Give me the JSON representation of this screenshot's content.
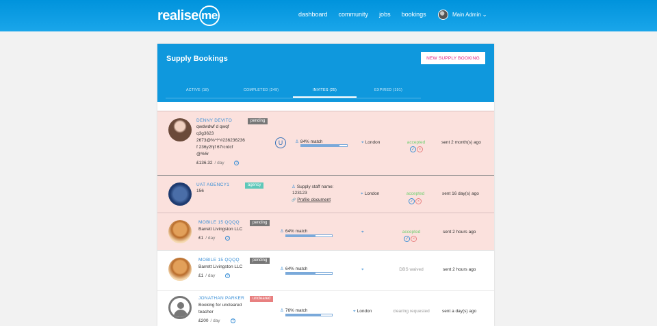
{
  "nav": {
    "logo_text": "realise",
    "logo_me": "me",
    "links": [
      "dashboard",
      "community",
      "jobs",
      "bookings"
    ],
    "user_name": "Main Admin",
    "user_caret": "⌄"
  },
  "panel": {
    "title": "Supply Bookings",
    "new_button": "NEW SUPPLY BOOKING",
    "tabs": [
      {
        "label": "ACTIVE (18)"
      },
      {
        "label": "COMPLETED (249)"
      },
      {
        "label": "INVITES (25)"
      },
      {
        "label": "EXPIRED (191)"
      }
    ]
  },
  "rows": [
    {
      "name": "DENNY DEVITO",
      "badge": "pending",
      "lines": [
        "qwdwdwf d qwqf",
        "q3g3623",
        "2673@%^!^#236236236",
        "f 236y2hjf 67rcrdcf",
        "@%5r"
      ],
      "rate": "£136.32",
      "per": "/ day",
      "u_icon": "U",
      "match": "84% match",
      "match_value": 84,
      "location": "London",
      "status": "accepted",
      "sent": "sent 2 month(s) ago"
    },
    {
      "name": "UAT AGENCY1",
      "badge": "agency",
      "lines": [
        "156"
      ],
      "staff_label": "Supply staff name:",
      "staff_value": "123123",
      "profile_link": "Profile document",
      "location": "London",
      "status": "accepted",
      "sent": "sent 16 day(s) ago"
    },
    {
      "name": "MOBILE 15 QQQQ",
      "badge": "pending",
      "lines": [
        "Barrett Livingston LLC"
      ],
      "rate": "£1",
      "per": "/ day",
      "match": "64% match",
      "match_value": 64,
      "status": "accepted",
      "sent": "sent 2 hours ago"
    },
    {
      "name": "MOBILE 15 QQQQ",
      "badge": "pending",
      "lines": [
        "Barrett Livingston LLC"
      ],
      "rate": "£1",
      "per": "/ day",
      "match": "64% match",
      "match_value": 64,
      "status": "DBS waived",
      "sent": "sent 2 hours ago"
    },
    {
      "name": "JONATHAN PARKER",
      "badge": "uncleared",
      "lines": [
        "Booking for uncleared",
        "teacher"
      ],
      "rate": "£200",
      "per": "/ day",
      "match": "76% match",
      "match_value": 76,
      "location": "London",
      "status": "clearing requested",
      "sent": "sent a day(s) ago"
    }
  ],
  "icons": {
    "tick": "✓",
    "cross": "×",
    "question": "?",
    "pin": "⌖",
    "person": "♙",
    "link": "🔗"
  },
  "colors": {
    "brand_blue": "#0f98dd",
    "accent_pink": "#e0197d",
    "row_pink": "#fbe1dd",
    "accepted_green": "#6fcf6f"
  }
}
